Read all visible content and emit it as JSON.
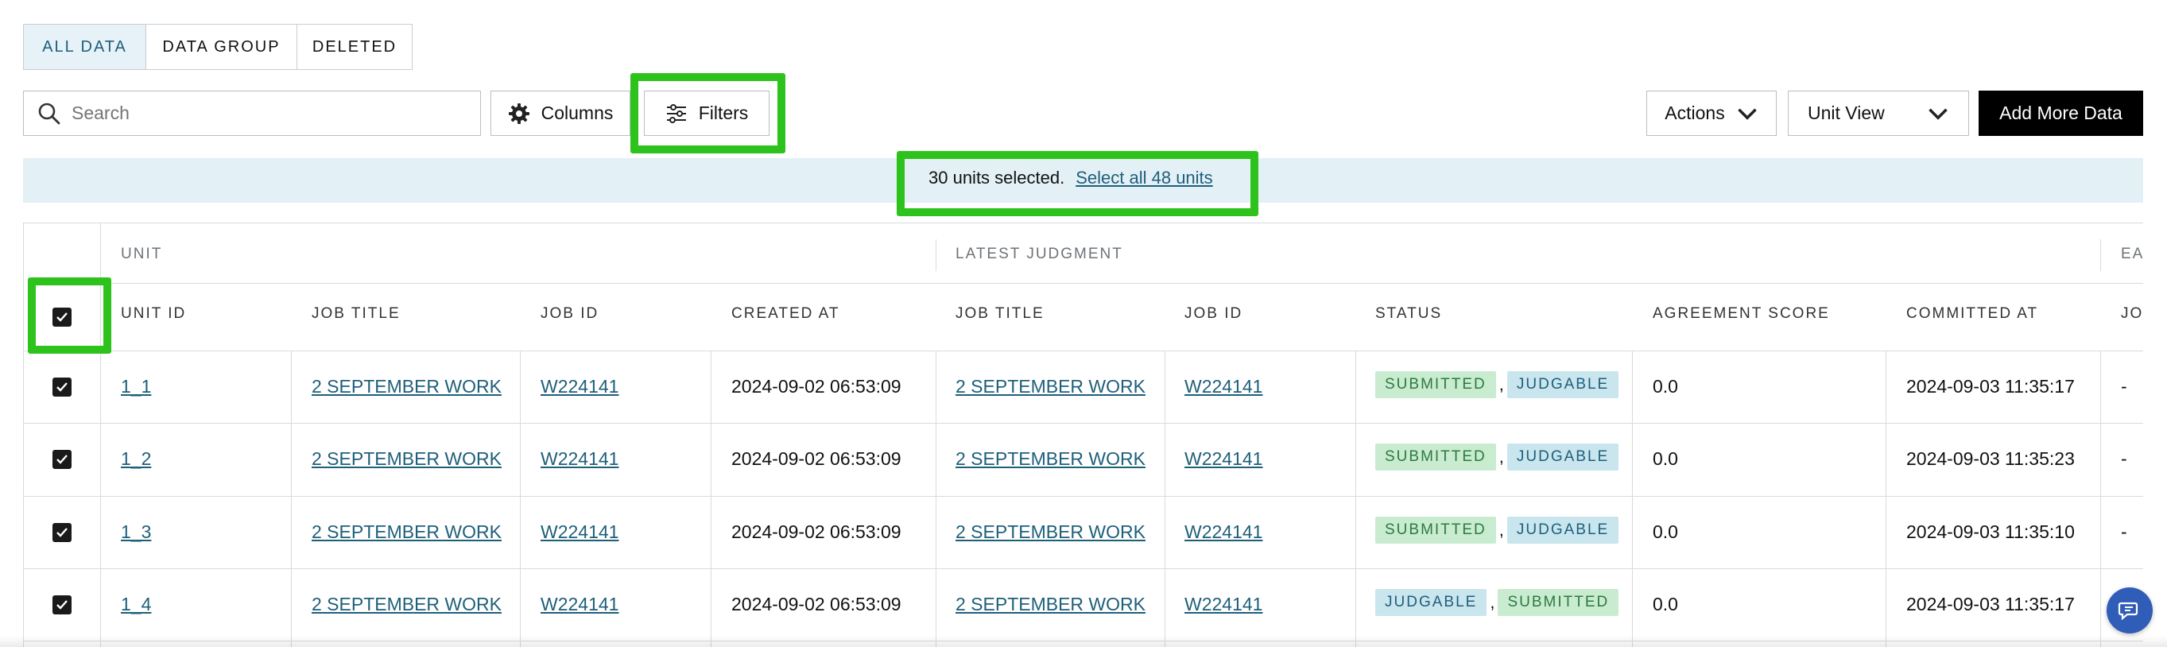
{
  "tabs": [
    {
      "label": "ALL DATA",
      "active": true
    },
    {
      "label": "DATA GROUP",
      "active": false
    },
    {
      "label": "DELETED",
      "active": false
    }
  ],
  "toolbar": {
    "search_placeholder": "Search",
    "columns_label": "Columns",
    "filters_label": "Filters",
    "actions_label": "Actions",
    "unit_view_label": "Unit View",
    "add_more_label": "Add More Data"
  },
  "selection": {
    "text": "30 units selected.",
    "select_all_link": "Select all 48 units"
  },
  "table": {
    "groups": {
      "unit": "UNIT",
      "latest": "LATEST JUDGMENT",
      "partial": "EA"
    },
    "headers": {
      "unit_id": "UNIT ID",
      "job_title": "JOB TITLE",
      "job_id": "JOB ID",
      "created_at": "CREATED AT",
      "latest_job_title": "JOB TITLE",
      "latest_job_id": "JOB ID",
      "status": "STATUS",
      "agreement_score": "AGREEMENT SCORE",
      "committed_at": "COMMITTED AT",
      "partial": "JO"
    },
    "rows": [
      {
        "unit_id": "1_1",
        "job_title": "2 SEPTEMBER WORK",
        "job_id": "W224141",
        "created_at": "2024-09-02 06:53:09",
        "latest_job_title": "2 SEPTEMBER WORK",
        "latest_job_id": "W224141",
        "status_1": "SUBMITTED",
        "status_2": "JUDGABLE",
        "comma": ",",
        "agreement": "0.0",
        "committed_at": "2024-09-03 11:35:17",
        "extra": "-"
      },
      {
        "unit_id": "1_2",
        "job_title": "2 SEPTEMBER WORK",
        "job_id": "W224141",
        "created_at": "2024-09-02 06:53:09",
        "latest_job_title": "2 SEPTEMBER WORK",
        "latest_job_id": "W224141",
        "status_1": "SUBMITTED",
        "status_2": "JUDGABLE",
        "comma": ",",
        "agreement": "0.0",
        "committed_at": "2024-09-03 11:35:23",
        "extra": "-"
      },
      {
        "unit_id": "1_3",
        "job_title": "2 SEPTEMBER WORK",
        "job_id": "W224141",
        "created_at": "2024-09-02 06:53:09",
        "latest_job_title": "2 SEPTEMBER WORK",
        "latest_job_id": "W224141",
        "status_1": "SUBMITTED",
        "status_2": "JUDGABLE",
        "comma": ",",
        "agreement": "0.0",
        "committed_at": "2024-09-03 11:35:10",
        "extra": "-"
      },
      {
        "unit_id": "1_4",
        "job_title": "2 SEPTEMBER WORK",
        "job_id": "W224141",
        "created_at": "2024-09-02 06:53:09",
        "latest_job_title": "2 SEPTEMBER WORK",
        "latest_job_id": "W224141",
        "status_1": "JUDGABLE",
        "status_2": "SUBMITTED",
        "comma": ",",
        "agreement": "0.0",
        "committed_at": "2024-09-03 11:35:17",
        "extra": "-"
      }
    ]
  },
  "colors": {
    "accent": "#1e5f7a",
    "highlight": "#2ec31c",
    "banner_bg": "#e3f0f5",
    "submitted_bg": "#c9ecd1",
    "judgable_bg": "#c9e5ee",
    "chat_button": "#2f5db8"
  },
  "icons": {
    "search": "search-icon",
    "columns": "gear-icon",
    "filters": "sliders-icon",
    "dropdown": "chevron-down-icon",
    "checkbox": "checkmark-icon",
    "chat": "chat-icon"
  }
}
